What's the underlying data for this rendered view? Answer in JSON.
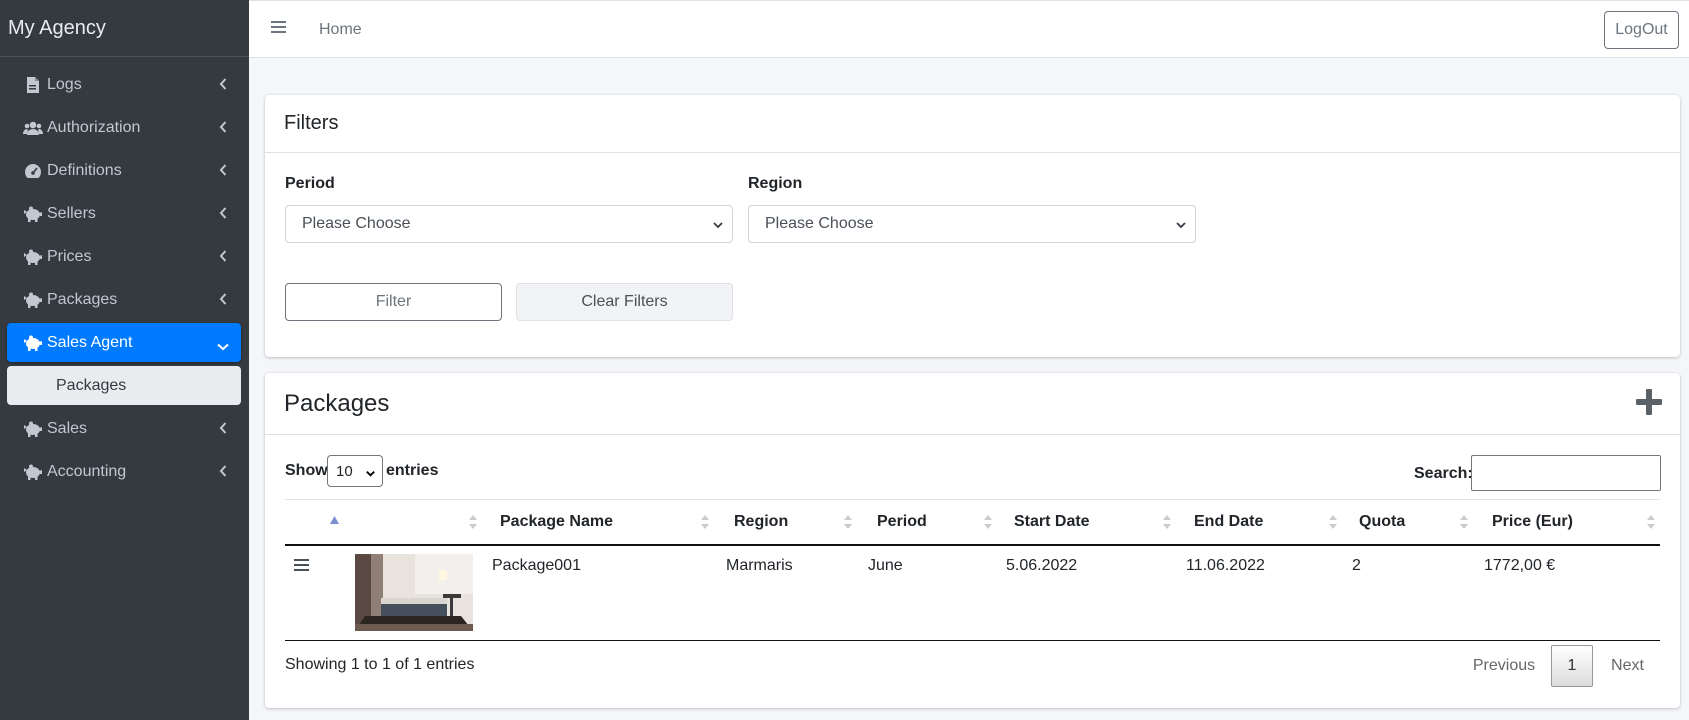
{
  "app": {
    "brand": "My Agency"
  },
  "sidebar": {
    "items": [
      {
        "label": "Logs",
        "icon": "file-icon"
      },
      {
        "label": "Authorization",
        "icon": "users-icon"
      },
      {
        "label": "Definitions",
        "icon": "gauge-icon"
      },
      {
        "label": "Sellers",
        "icon": "piggy-bank-icon"
      },
      {
        "label": "Prices",
        "icon": "piggy-bank-icon"
      },
      {
        "label": "Packages",
        "icon": "piggy-bank-icon"
      },
      {
        "label": "Sales Agent",
        "icon": "piggy-bank-icon",
        "active": true
      },
      {
        "label": "Sales",
        "icon": "piggy-bank-icon"
      },
      {
        "label": "Accounting",
        "icon": "piggy-bank-icon"
      }
    ],
    "sub_items": [
      {
        "label": "Packages"
      }
    ]
  },
  "topbar": {
    "home": "Home",
    "logout": "LogOut"
  },
  "filters": {
    "title": "Filters",
    "period_label": "Period",
    "period_value": "Please Choose",
    "region_label": "Region",
    "region_value": "Please Choose",
    "filter_button": "Filter",
    "clear_button": "Clear Filters"
  },
  "packages": {
    "title": "Packages",
    "show_label": "Show",
    "entries_value": "10",
    "entries_label": "entries",
    "search_label": "Search:",
    "columns": [
      "Package Name",
      "Region",
      "Period",
      "Start Date",
      "End Date",
      "Quota",
      "Price (Eur)"
    ],
    "rows": [
      {
        "name": "Package001",
        "region": "Marmaris",
        "period": "June",
        "start": "5.06.2022",
        "end": "11.06.2022",
        "quota": "2",
        "price": "1772,00 €"
      }
    ],
    "info": "Showing 1 to 1 of 1 entries",
    "pagination": {
      "previous": "Previous",
      "current": "1",
      "next": "Next"
    }
  },
  "colors": {
    "sidebar_bg": "#343a40",
    "active": "#007bff",
    "page_bg": "#f4f6f9"
  }
}
